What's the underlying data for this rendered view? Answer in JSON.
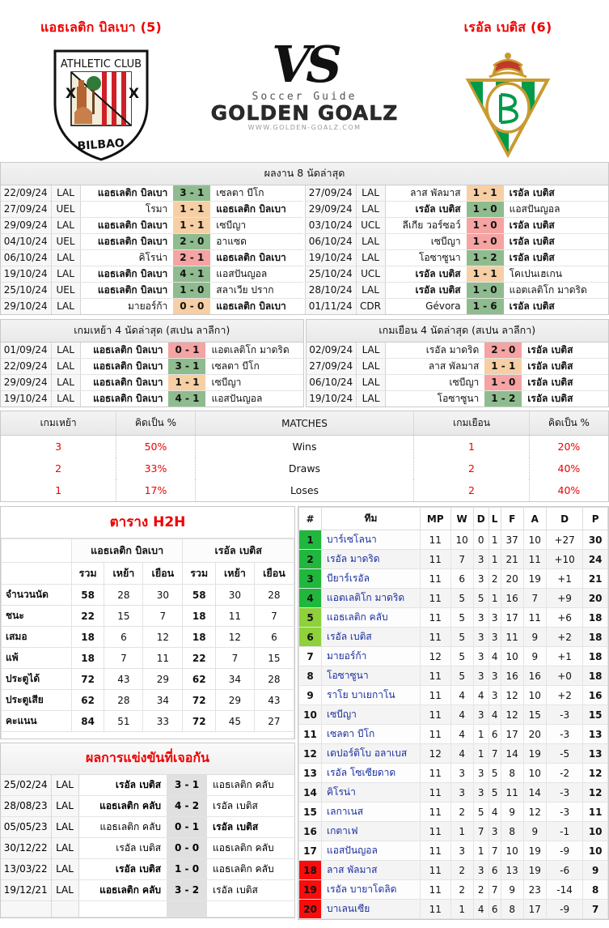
{
  "header": {
    "home_team": "แอธเลติก บิลเบา (5)",
    "away_team": "เรอัล เบติส (6)",
    "vs_label": "VS",
    "brand_top": "Soccer Guide",
    "brand_main": "GOLDEN GOALZ",
    "brand_url": "WWW.GOLDEN-GOALZ.COM",
    "home_crest_alt": "athletic-club-bilbao-crest",
    "away_crest_alt": "real-betis-crest"
  },
  "last8": {
    "title": "ผลงาน 8 นัดล่าสุด",
    "home_rows": [
      {
        "date": "22/09/24",
        "comp": "LAL",
        "home": "แอธเลติก บิลเบา",
        "score": "3 - 1",
        "away": "เซลตา บีโก",
        "result": "w",
        "home_bold": true,
        "away_bold": false
      },
      {
        "date": "27/09/24",
        "comp": "UEL",
        "home": "โรมา",
        "score": "1 - 1",
        "away": "แอธเลติก บิลเบา",
        "result": "d",
        "home_bold": false,
        "away_bold": true
      },
      {
        "date": "29/09/24",
        "comp": "LAL",
        "home": "แอธเลติก บิลเบา",
        "score": "1 - 1",
        "away": "เซบีญา",
        "result": "d",
        "home_bold": true,
        "away_bold": false
      },
      {
        "date": "04/10/24",
        "comp": "UEL",
        "home": "แอธเลติก บิลเบา",
        "score": "2 - 0",
        "away": "อาแซด",
        "result": "w",
        "home_bold": true,
        "away_bold": false
      },
      {
        "date": "06/10/24",
        "comp": "LAL",
        "home": "คิโรน่า",
        "score": "2 - 1",
        "away": "แอธเลติก บิลเบา",
        "result": "l",
        "home_bold": false,
        "away_bold": true
      },
      {
        "date": "19/10/24",
        "comp": "LAL",
        "home": "แอธเลติก บิลเบา",
        "score": "4 - 1",
        "away": "แอสปันญอล",
        "result": "w",
        "home_bold": true,
        "away_bold": false
      },
      {
        "date": "25/10/24",
        "comp": "UEL",
        "home": "แอธเลติก บิลเบา",
        "score": "1 - 0",
        "away": "สลาเวีย ปราก",
        "result": "w",
        "home_bold": true,
        "away_bold": false
      },
      {
        "date": "29/10/24",
        "comp": "LAL",
        "home": "มายอร์ก้า",
        "score": "0 - 0",
        "away": "แอธเลติก บิลเบา",
        "result": "d",
        "home_bold": false,
        "away_bold": true
      }
    ],
    "away_rows": [
      {
        "date": "27/09/24",
        "comp": "LAL",
        "home": "ลาส พัลมาส",
        "score": "1 - 1",
        "away": "เรอัล เบติส",
        "result": "d",
        "home_bold": false,
        "away_bold": true
      },
      {
        "date": "29/09/24",
        "comp": "LAL",
        "home": "เรอัล เบติส",
        "score": "1 - 0",
        "away": "แอสปันญอล",
        "result": "w",
        "home_bold": true,
        "away_bold": false
      },
      {
        "date": "03/10/24",
        "comp": "UCL",
        "home": "ลีเกีย วอร์ซอว์",
        "score": "1 - 0",
        "away": "เรอัล เบติส",
        "result": "l",
        "home_bold": false,
        "away_bold": true
      },
      {
        "date": "06/10/24",
        "comp": "LAL",
        "home": "เซบีญา",
        "score": "1 - 0",
        "away": "เรอัล เบติส",
        "result": "l",
        "home_bold": false,
        "away_bold": true
      },
      {
        "date": "19/10/24",
        "comp": "LAL",
        "home": "โอซาซูนา",
        "score": "1 - 2",
        "away": "เรอัล เบติส",
        "result": "w",
        "home_bold": false,
        "away_bold": true
      },
      {
        "date": "25/10/24",
        "comp": "UCL",
        "home": "เรอัล เบติส",
        "score": "1 - 1",
        "away": "โคเปนเฮเกน",
        "result": "d",
        "home_bold": true,
        "away_bold": false
      },
      {
        "date": "28/10/24",
        "comp": "LAL",
        "home": "เรอัล เบติส",
        "score": "1 - 0",
        "away": "แอตเลติโก มาดริด",
        "result": "w",
        "home_bold": true,
        "away_bold": false
      },
      {
        "date": "01/11/24",
        "comp": "CDR",
        "home": "Gévora",
        "score": "1 - 6",
        "away": "เรอัล เบติส",
        "result": "w",
        "home_bold": false,
        "away_bold": true
      }
    ]
  },
  "last4": {
    "home_title": "เกมเหย้า 4 นัดล่าสุด (สเปน ลาลีกา)",
    "away_title": "เกมเยือน 4 นัดล่าสุด (สเปน ลาลีกา)",
    "home_rows": [
      {
        "date": "01/09/24",
        "comp": "LAL",
        "home": "แอธเลติก บิลเบา",
        "score": "0 - 1",
        "away": "แอตเลติโก มาดริด",
        "result": "l",
        "home_bold": true,
        "away_bold": false
      },
      {
        "date": "22/09/24",
        "comp": "LAL",
        "home": "แอธเลติก บิลเบา",
        "score": "3 - 1",
        "away": "เซลตา บีโก",
        "result": "w",
        "home_bold": true,
        "away_bold": false
      },
      {
        "date": "29/09/24",
        "comp": "LAL",
        "home": "แอธเลติก บิลเบา",
        "score": "1 - 1",
        "away": "เซบีญา",
        "result": "d",
        "home_bold": true,
        "away_bold": false
      },
      {
        "date": "19/10/24",
        "comp": "LAL",
        "home": "แอธเลติก บิลเบา",
        "score": "4 - 1",
        "away": "แอสปันญอล",
        "result": "w",
        "home_bold": true,
        "away_bold": false
      }
    ],
    "away_rows": [
      {
        "date": "02/09/24",
        "comp": "LAL",
        "home": "เรอัล มาดริด",
        "score": "2 - 0",
        "away": "เรอัล เบติส",
        "result": "l",
        "home_bold": false,
        "away_bold": true
      },
      {
        "date": "27/09/24",
        "comp": "LAL",
        "home": "ลาส พัลมาส",
        "score": "1 - 1",
        "away": "เรอัล เบติส",
        "result": "d",
        "home_bold": false,
        "away_bold": true
      },
      {
        "date": "06/10/24",
        "comp": "LAL",
        "home": "เซบีญา",
        "score": "1 - 0",
        "away": "เรอัล เบติส",
        "result": "l",
        "home_bold": false,
        "away_bold": true
      },
      {
        "date": "19/10/24",
        "comp": "LAL",
        "home": "โอซาซูนา",
        "score": "1 - 2",
        "away": "เรอัล เบติส",
        "result": "w",
        "home_bold": false,
        "away_bold": true
      }
    ]
  },
  "summary": {
    "headers": [
      "เกมเหย้า",
      "คิดเป็น %",
      "MATCHES",
      "เกมเยือน",
      "คิดเป็น %"
    ],
    "rows": [
      {
        "home": "3",
        "home_pct": "50%",
        "label": "Wins",
        "away": "1",
        "away_pct": "20%"
      },
      {
        "home": "2",
        "home_pct": "33%",
        "label": "Draws",
        "away": "2",
        "away_pct": "40%"
      },
      {
        "home": "1",
        "home_pct": "17%",
        "label": "Loses",
        "away": "2",
        "away_pct": "40%"
      }
    ]
  },
  "h2h": {
    "title": "ตาราง H2H",
    "home_team": "แอธเลติก บิลเบา",
    "away_team": "เรอัล เบติส",
    "sub_headers": [
      "รวม",
      "เหย้า",
      "เยือน",
      "รวม",
      "เหย้า",
      "เยือน"
    ],
    "rows": [
      {
        "label": "จำนวนนัด",
        "v": [
          "58",
          "28",
          "30",
          "58",
          "30",
          "28"
        ]
      },
      {
        "label": "ชนะ",
        "v": [
          "22",
          "15",
          "7",
          "18",
          "11",
          "7"
        ]
      },
      {
        "label": "เสมอ",
        "v": [
          "18",
          "6",
          "12",
          "18",
          "12",
          "6"
        ]
      },
      {
        "label": "แพ้",
        "v": [
          "18",
          "7",
          "11",
          "22",
          "7",
          "15"
        ]
      },
      {
        "label": "ประตูได้",
        "v": [
          "72",
          "43",
          "29",
          "62",
          "34",
          "28"
        ]
      },
      {
        "label": "ประตูเสีย",
        "v": [
          "62",
          "28",
          "34",
          "72",
          "29",
          "43"
        ]
      },
      {
        "label": "คะแนน",
        "v": [
          "84",
          "51",
          "33",
          "72",
          "45",
          "27"
        ]
      }
    ]
  },
  "meetings": {
    "title": "ผลการแข่งขันที่เจอกัน",
    "rows": [
      {
        "date": "25/02/24",
        "comp": "LAL",
        "home": "เรอัล เบติส",
        "score": "3 - 1",
        "away": "แอธเลติก คลับ",
        "home_bold": true,
        "away_bold": false
      },
      {
        "date": "28/08/23",
        "comp": "LAL",
        "home": "แอธเลติก คลับ",
        "score": "4 - 2",
        "away": "เรอัล เบติส",
        "home_bold": true,
        "away_bold": false
      },
      {
        "date": "05/05/23",
        "comp": "LAL",
        "home": "แอธเลติก คลับ",
        "score": "0 - 1",
        "away": "เรอัล เบติส",
        "home_bold": false,
        "away_bold": true
      },
      {
        "date": "30/12/22",
        "comp": "LAL",
        "home": "เรอัล เบติส",
        "score": "0 - 0",
        "away": "แอธเลติก คลับ",
        "home_bold": false,
        "away_bold": false
      },
      {
        "date": "13/03/22",
        "comp": "LAL",
        "home": "เรอัล เบติส",
        "score": "1 - 0",
        "away": "แอธเลติก คลับ",
        "home_bold": true,
        "away_bold": false
      },
      {
        "date": "19/12/21",
        "comp": "LAL",
        "home": "แอธเลติก คลับ",
        "score": "3 - 2",
        "away": "เรอัล เบติส",
        "home_bold": true,
        "away_bold": false
      }
    ]
  },
  "standings": {
    "headers": [
      "#",
      "ทีม",
      "MP",
      "W",
      "D",
      "L",
      "F",
      "A",
      "D",
      "P"
    ],
    "rows": [
      {
        "rank": "1",
        "team": "บาร์เซโลนา",
        "mp": "11",
        "w": "10",
        "d": "0",
        "l": "1",
        "f": "37",
        "a": "10",
        "gd": "+27",
        "p": "30",
        "zone": "ucl"
      },
      {
        "rank": "2",
        "team": "เรอัล มาดริด",
        "mp": "11",
        "w": "7",
        "d": "3",
        "l": "1",
        "f": "21",
        "a": "11",
        "gd": "+10",
        "p": "24",
        "zone": "ucl"
      },
      {
        "rank": "3",
        "team": "บียาร์เรอัล",
        "mp": "11",
        "w": "6",
        "d": "3",
        "l": "2",
        "f": "20",
        "a": "19",
        "gd": "+1",
        "p": "21",
        "zone": "ucl"
      },
      {
        "rank": "4",
        "team": "แอตเลติโก มาดริด",
        "mp": "11",
        "w": "5",
        "d": "5",
        "l": "1",
        "f": "16",
        "a": "7",
        "gd": "+9",
        "p": "20",
        "zone": "ucl"
      },
      {
        "rank": "5",
        "team": "แอธเลติก คลับ",
        "mp": "11",
        "w": "5",
        "d": "3",
        "l": "3",
        "f": "17",
        "a": "11",
        "gd": "+6",
        "p": "18",
        "zone": "uel"
      },
      {
        "rank": "6",
        "team": "เรอัล เบติส",
        "mp": "11",
        "w": "5",
        "d": "3",
        "l": "3",
        "f": "11",
        "a": "9",
        "gd": "+2",
        "p": "18",
        "zone": "uel"
      },
      {
        "rank": "7",
        "team": "มายอร์ก้า",
        "mp": "12",
        "w": "5",
        "d": "3",
        "l": "4",
        "f": "10",
        "a": "9",
        "gd": "+1",
        "p": "18",
        "zone": ""
      },
      {
        "rank": "8",
        "team": "โอซาซูนา",
        "mp": "11",
        "w": "5",
        "d": "3",
        "l": "3",
        "f": "16",
        "a": "16",
        "gd": "+0",
        "p": "18",
        "zone": ""
      },
      {
        "rank": "9",
        "team": "ราโย บาเยกาโน",
        "mp": "11",
        "w": "4",
        "d": "4",
        "l": "3",
        "f": "12",
        "a": "10",
        "gd": "+2",
        "p": "16",
        "zone": ""
      },
      {
        "rank": "10",
        "team": "เซบีญา",
        "mp": "11",
        "w": "4",
        "d": "3",
        "l": "4",
        "f": "12",
        "a": "15",
        "gd": "-3",
        "p": "15",
        "zone": ""
      },
      {
        "rank": "11",
        "team": "เซลตา บีโก",
        "mp": "11",
        "w": "4",
        "d": "1",
        "l": "6",
        "f": "17",
        "a": "20",
        "gd": "-3",
        "p": "13",
        "zone": ""
      },
      {
        "rank": "12",
        "team": "เดปอร์ติโบ อลาเบส",
        "mp": "12",
        "w": "4",
        "d": "1",
        "l": "7",
        "f": "14",
        "a": "19",
        "gd": "-5",
        "p": "13",
        "zone": ""
      },
      {
        "rank": "13",
        "team": "เรอัล โซเซียดาด",
        "mp": "11",
        "w": "3",
        "d": "3",
        "l": "5",
        "f": "8",
        "a": "10",
        "gd": "-2",
        "p": "12",
        "zone": ""
      },
      {
        "rank": "14",
        "team": "คิโรน่า",
        "mp": "11",
        "w": "3",
        "d": "3",
        "l": "5",
        "f": "11",
        "a": "14",
        "gd": "-3",
        "p": "12",
        "zone": ""
      },
      {
        "rank": "15",
        "team": "เลกาเนส",
        "mp": "11",
        "w": "2",
        "d": "5",
        "l": "4",
        "f": "9",
        "a": "12",
        "gd": "-3",
        "p": "11",
        "zone": ""
      },
      {
        "rank": "16",
        "team": "เกตาเฟ",
        "mp": "11",
        "w": "1",
        "d": "7",
        "l": "3",
        "f": "8",
        "a": "9",
        "gd": "-1",
        "p": "10",
        "zone": ""
      },
      {
        "rank": "17",
        "team": "แอสปันญอล",
        "mp": "11",
        "w": "3",
        "d": "1",
        "l": "7",
        "f": "10",
        "a": "19",
        "gd": "-9",
        "p": "10",
        "zone": ""
      },
      {
        "rank": "18",
        "team": "ลาส พัลมาส",
        "mp": "11",
        "w": "2",
        "d": "3",
        "l": "6",
        "f": "13",
        "a": "19",
        "gd": "-6",
        "p": "9",
        "zone": "rel"
      },
      {
        "rank": "19",
        "team": "เรอัล บายาโดลิด",
        "mp": "11",
        "w": "2",
        "d": "2",
        "l": "7",
        "f": "9",
        "a": "23",
        "gd": "-14",
        "p": "8",
        "zone": "rel"
      },
      {
        "rank": "20",
        "team": "บาเลนเซีย",
        "mp": "11",
        "w": "1",
        "d": "4",
        "l": "6",
        "f": "8",
        "a": "17",
        "gd": "-9",
        "p": "7",
        "zone": "rel"
      }
    ]
  },
  "colors": {
    "win": "#8fbc8f",
    "draw": "#f7cfa5",
    "loss": "#f5a3a3",
    "neutral": "#e0e0e0",
    "team_red": "#ee0000",
    "team_blue": "#1b5fbe",
    "zone_ucl": "#1fb83c",
    "zone_uel": "#8ed13a",
    "zone_rel": "#f90c0c"
  }
}
